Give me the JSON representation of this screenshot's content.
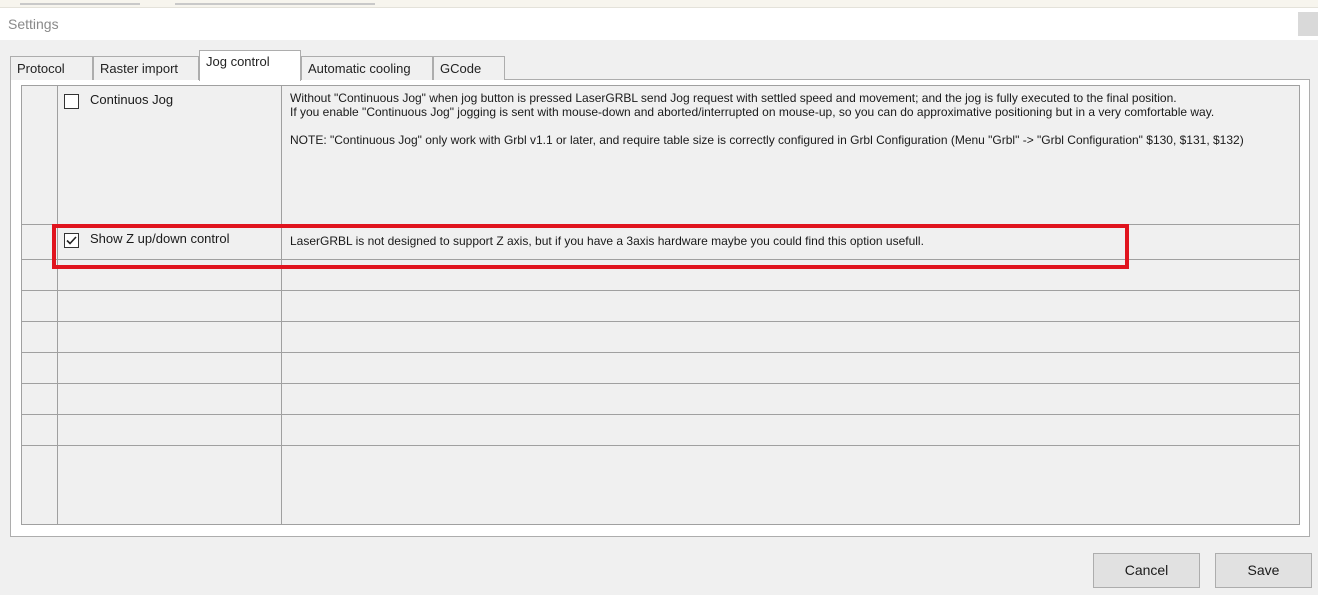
{
  "window": {
    "title": "Settings"
  },
  "tabs": [
    {
      "label": "Protocol",
      "active": false
    },
    {
      "label": "Raster import",
      "active": false
    },
    {
      "label": "Jog control",
      "active": true
    },
    {
      "label": "Automatic cooling",
      "active": false
    },
    {
      "label": "GCode",
      "active": false
    }
  ],
  "settings_rows": [
    {
      "name": "Continuos Jog",
      "checked": false,
      "description": [
        "Without \"Continuous Jog\" when jog button is pressed LaserGRBL send Jog request with settled speed and movement; and the jog is fully executed to the final position.",
        "If you enable \"Continuous Jog\" jogging is sent with mouse-down and aborted/interrupted on mouse-up, so you can do approximative positioning but in a very comfortable way.",
        "",
        "NOTE: \"Continuous Jog\" only work with Grbl v1.1 or later, and require table size is correctly configured in Grbl Configuration (Menu \"Grbl\" -> \"Grbl Configuration\" $130, $131, $132)"
      ]
    },
    {
      "name": "Show Z up/down control",
      "checked": true,
      "description": [
        "LaserGRBL is not designed to support Z axis, but if you have a 3axis hardware maybe you could find this option usefull."
      ]
    }
  ],
  "empty_rows": 8,
  "buttons": {
    "cancel": "Cancel",
    "save": "Save"
  },
  "colors": {
    "highlight": "#e0141e",
    "window_bg": "#f0f0f0",
    "grid_line": "#a0a0a0"
  }
}
